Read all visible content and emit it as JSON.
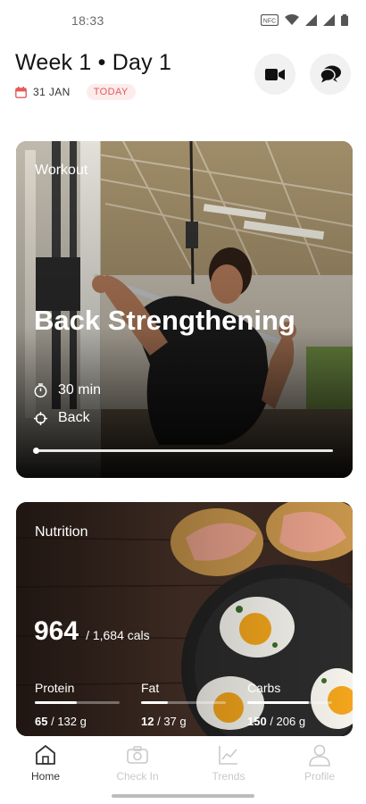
{
  "status_bar": {
    "time": "18:33"
  },
  "header": {
    "title": "Week 1 • Day 1",
    "date": "31 JAN",
    "today_badge": "TODAY",
    "icons": [
      "calendar-icon",
      "video-icon",
      "chat-icon"
    ]
  },
  "workout": {
    "label": "Workout",
    "title": "Back Strengthening",
    "duration": "30 min",
    "area": "Back",
    "progress_fraction": 0.0
  },
  "nutrition": {
    "label": "Nutrition",
    "calories": "964",
    "calories_target": "/ 1,684 cals",
    "macros": [
      {
        "name": "Protein",
        "value": "65",
        "target": "/ 132 g",
        "fraction": 0.49
      },
      {
        "name": "Fat",
        "value": "12",
        "target": "/ 37 g",
        "fraction": 0.32
      },
      {
        "name": "Carbs",
        "value": "150",
        "target": "/ 206 g",
        "fraction": 0.73
      }
    ]
  },
  "nav": {
    "tabs": [
      {
        "label": "Home",
        "icon": "home-icon",
        "active": true
      },
      {
        "label": "Check In",
        "icon": "camera-icon",
        "active": false
      },
      {
        "label": "Trends",
        "icon": "trends-icon",
        "active": false
      },
      {
        "label": "Profile",
        "icon": "profile-icon",
        "active": false
      }
    ]
  },
  "colors": {
    "accent": "#e45a5a",
    "badge_bg": "#fdecec",
    "inactive_tab": "#c9c9c9"
  }
}
